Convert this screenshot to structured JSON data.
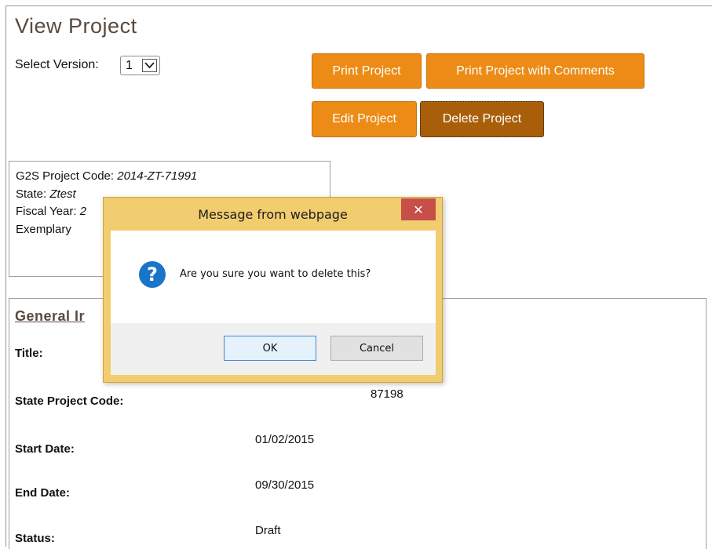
{
  "page": {
    "title": "View Project"
  },
  "version": {
    "label": "Select Version:",
    "selected": "1"
  },
  "actions": {
    "print_project": "Print Project",
    "print_with_comments": "Print Project with Comments",
    "edit_project": "Edit Project",
    "delete_project": "Delete Project"
  },
  "info": {
    "code_label": "G2S Project Code:",
    "code_value": "2014-ZT-71991",
    "state_label": "State:",
    "state_value": "Ztest",
    "fiscal_label": "Fiscal Year:",
    "fiscal_value": "2",
    "exemplary": "Exemplary"
  },
  "general": {
    "section_title": "General Ir",
    "fields": {
      "title_label": "Title:",
      "state_code_label": "State Project Code:",
      "state_code_value": "87198",
      "start_label": "Start Date:",
      "start_value": "01/02/2015",
      "end_label": "End Date:",
      "end_value": "09/30/2015",
      "status_label": "Status:",
      "status_value": "Draft"
    }
  },
  "dialog": {
    "title": "Message from webpage",
    "message": "Are you sure you want to delete this?",
    "ok_label": "OK",
    "cancel_label": "Cancel",
    "close_glyph": "✕",
    "icon_glyph": "?",
    "icon_color": "#1a74c9"
  },
  "colors": {
    "button_orange": "#ec8b16",
    "button_pressed": "#a95f0a",
    "title_brown": "#5b4a3e",
    "dialog_frame": "#f2cd6f",
    "close_red": "#c74f49"
  }
}
